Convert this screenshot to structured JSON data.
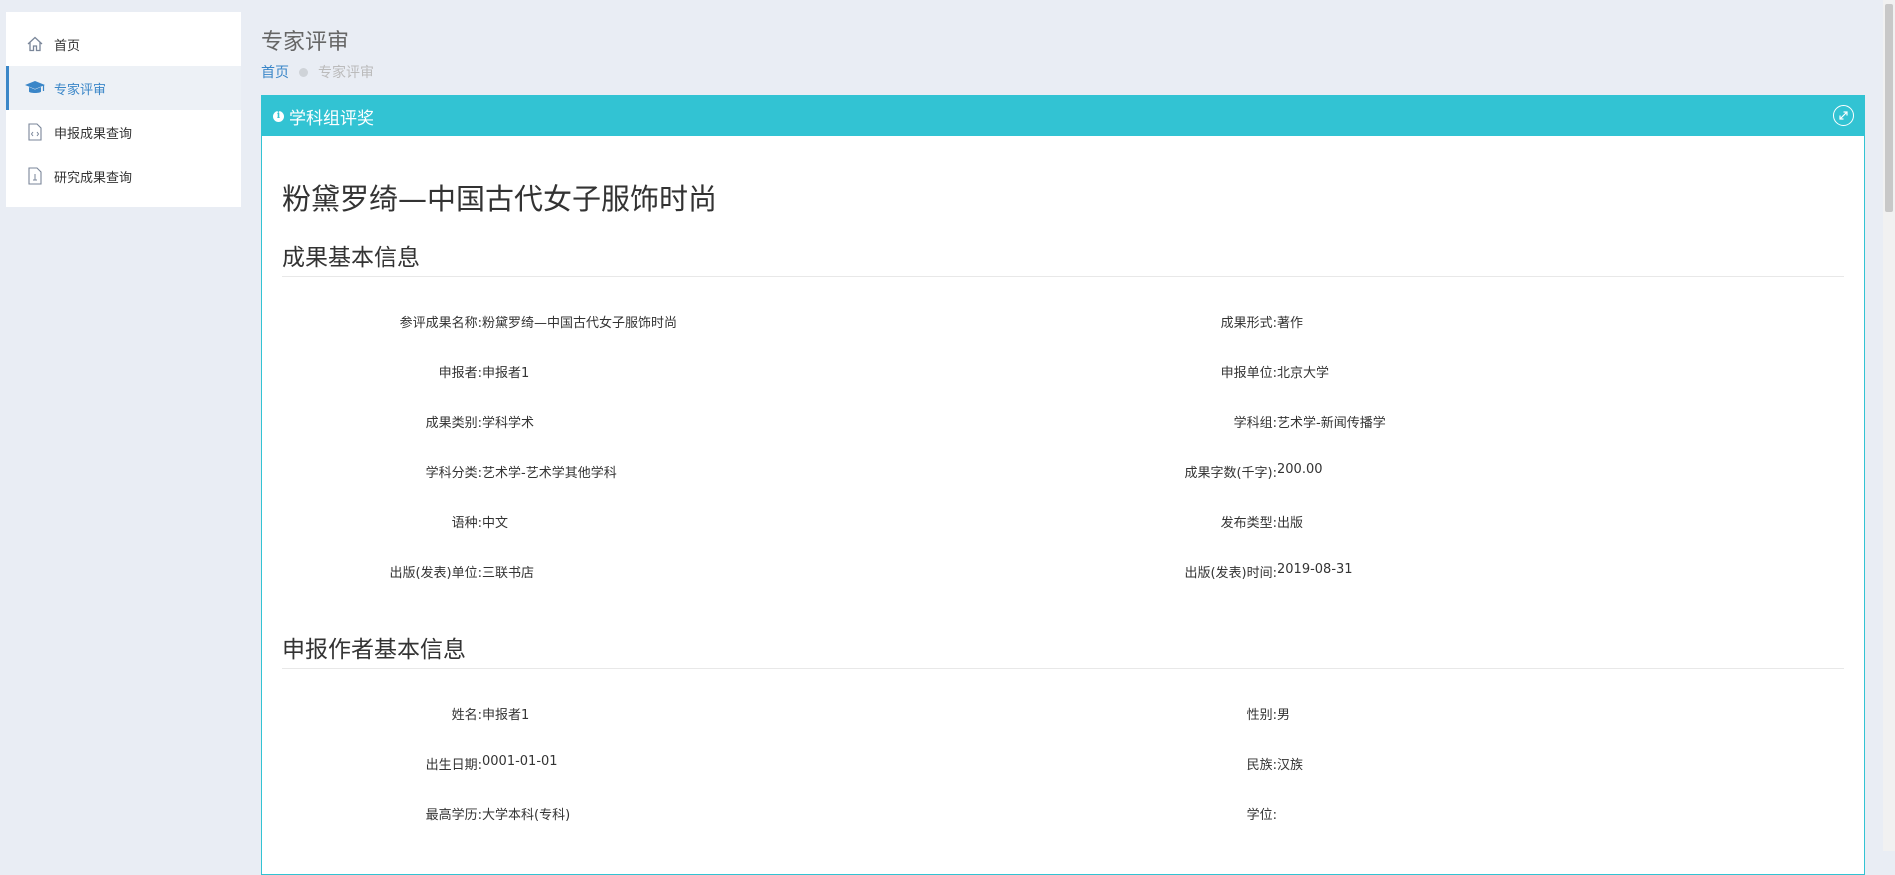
{
  "sidebar": {
    "items": [
      {
        "label": "首页",
        "icon": "home-icon"
      },
      {
        "label": "专家评审",
        "icon": "graduation-cap-icon",
        "active": true
      },
      {
        "label": "申报成果查询",
        "icon": "code-file-icon"
      },
      {
        "label": "研究成果查询",
        "icon": "document-icon"
      }
    ]
  },
  "header": {
    "title": "专家评审",
    "breadcrumb": {
      "home": "首页",
      "current": "专家评审"
    }
  },
  "panel": {
    "title": "学科组评奖",
    "accent_color": "#32c3d3",
    "work_title": "粉黛罗绮—中国古代女子服饰时尚",
    "sections": [
      {
        "title": "成果基本信息",
        "rows": [
          [
            {
              "label": "参评成果名称:",
              "value": "粉黛罗绮—中国古代女子服饰时尚"
            },
            {
              "label": "成果形式:",
              "value": "著作"
            }
          ],
          [
            {
              "label": "申报者:",
              "value": "申报者1"
            },
            {
              "label": "申报单位:",
              "value": "北京大学"
            }
          ],
          [
            {
              "label": "成果类别:",
              "value": "学科学术"
            },
            {
              "label": "学科组:",
              "value": "艺术学-新闻传播学"
            }
          ],
          [
            {
              "label": "学科分类:",
              "value": "艺术学-艺术学其他学科"
            },
            {
              "label": "成果字数(千字):",
              "value": "200.00"
            }
          ],
          [
            {
              "label": "语种:",
              "value": "中文"
            },
            {
              "label": "发布类型:",
              "value": "出版"
            }
          ],
          [
            {
              "label": "出版(发表)单位:",
              "value": "三联书店"
            },
            {
              "label": "出版(发表)时间:",
              "value": "2019-08-31"
            }
          ]
        ]
      },
      {
        "title": "申报作者基本信息",
        "rows": [
          [
            {
              "label": "姓名:",
              "value": "申报者1"
            },
            {
              "label": "性别:",
              "value": "男"
            }
          ],
          [
            {
              "label": "出生日期:",
              "value": "0001-01-01"
            },
            {
              "label": "民族:",
              "value": "汉族"
            }
          ],
          [
            {
              "label": "最高学历:",
              "value": "大学本科(专科)"
            },
            {
              "label": "学位:",
              "value": ""
            }
          ]
        ]
      }
    ]
  }
}
